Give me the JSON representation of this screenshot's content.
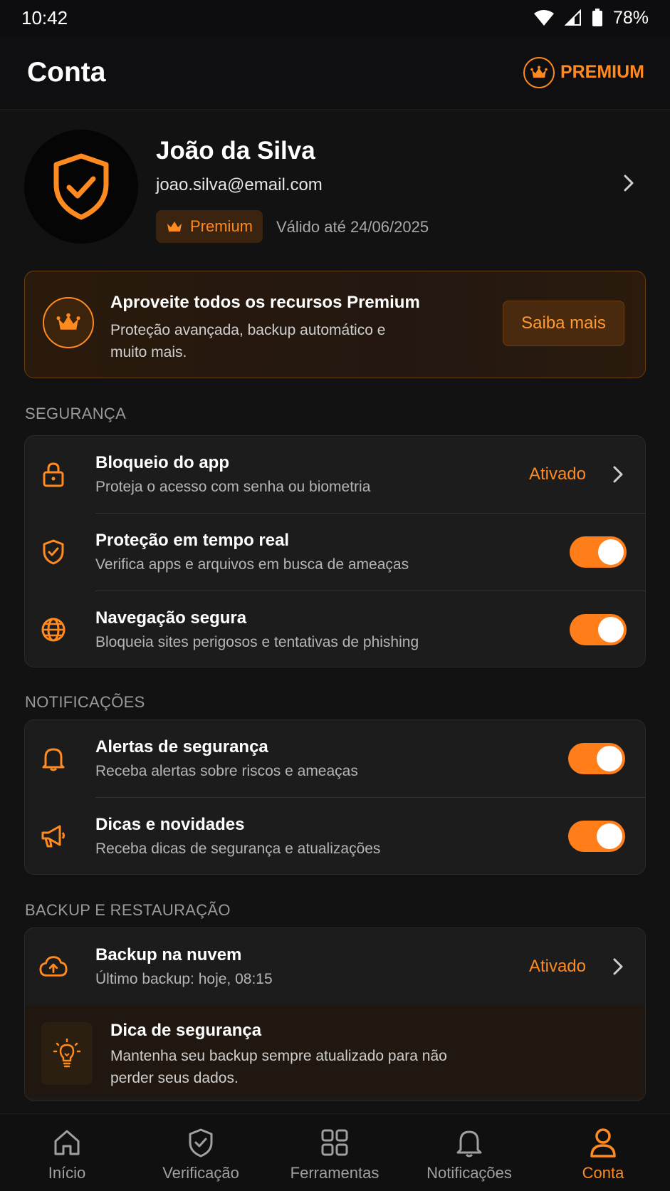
{
  "status_bar": {
    "time": "10:42",
    "battery": "78%"
  },
  "header": {
    "title": "Conta",
    "premium_label": "PREMIUM"
  },
  "profile": {
    "name": "João da Silva",
    "email": "joao.silva@email.com",
    "badge": "Premium",
    "valid_until": "Válido até 24/06/2025"
  },
  "promo": {
    "title": "Aproveite todos os recursos Premium",
    "description": "Proteção avançada, backup automático e muito mais.",
    "button": "Saiba mais"
  },
  "security": {
    "header": "SEGURANÇA",
    "items": [
      {
        "title": "Bloqueio do app",
        "subtitle": "Proteja o acesso com senha ou biometria",
        "status": "Ativado",
        "icon": "lock-icon"
      },
      {
        "title": "Proteção em tempo real",
        "subtitle": "Verifica apps e arquivos em busca de ameaças",
        "toggle": true,
        "icon": "shield-check-icon"
      },
      {
        "title": "Navegação segura",
        "subtitle": "Bloqueia sites perigosos e tentativas de phishing",
        "toggle": true,
        "icon": "globe-icon"
      }
    ]
  },
  "notifications": {
    "header": "NOTIFICAÇÕES",
    "items": [
      {
        "title": "Alertas de segurança",
        "subtitle": "Receba alertas sobre riscos e ameaças",
        "toggle": true,
        "icon": "bell-icon"
      },
      {
        "title": "Dicas e novidades",
        "subtitle": "Receba dicas de segurança e atualizações",
        "toggle": true,
        "icon": "megaphone-icon"
      }
    ]
  },
  "backup": {
    "header": "BACKUP E RESTAURAÇÃO",
    "item": {
      "title": "Backup na nuvem",
      "subtitle": "Último backup: hoje, 08:15",
      "status": "Ativado",
      "icon": "cloud-upload-icon"
    },
    "tip": {
      "title": "Dica de segurança",
      "description": "Mantenha seu backup sempre atualizado para não perder seus dados.",
      "icon": "lightbulb-icon"
    }
  },
  "bottom_nav": [
    {
      "label": "Início",
      "icon": "home-icon"
    },
    {
      "label": "Verificação",
      "icon": "shield-check-icon"
    },
    {
      "label": "Ferramentas",
      "icon": "grid-icon"
    },
    {
      "label": "Notificações",
      "icon": "bell-icon"
    },
    {
      "label": "Conta",
      "icon": "user-icon",
      "active": true
    }
  ],
  "colors": {
    "accent": "#ff8a1f",
    "background": "#121212",
    "card": "#1c1c1d"
  }
}
